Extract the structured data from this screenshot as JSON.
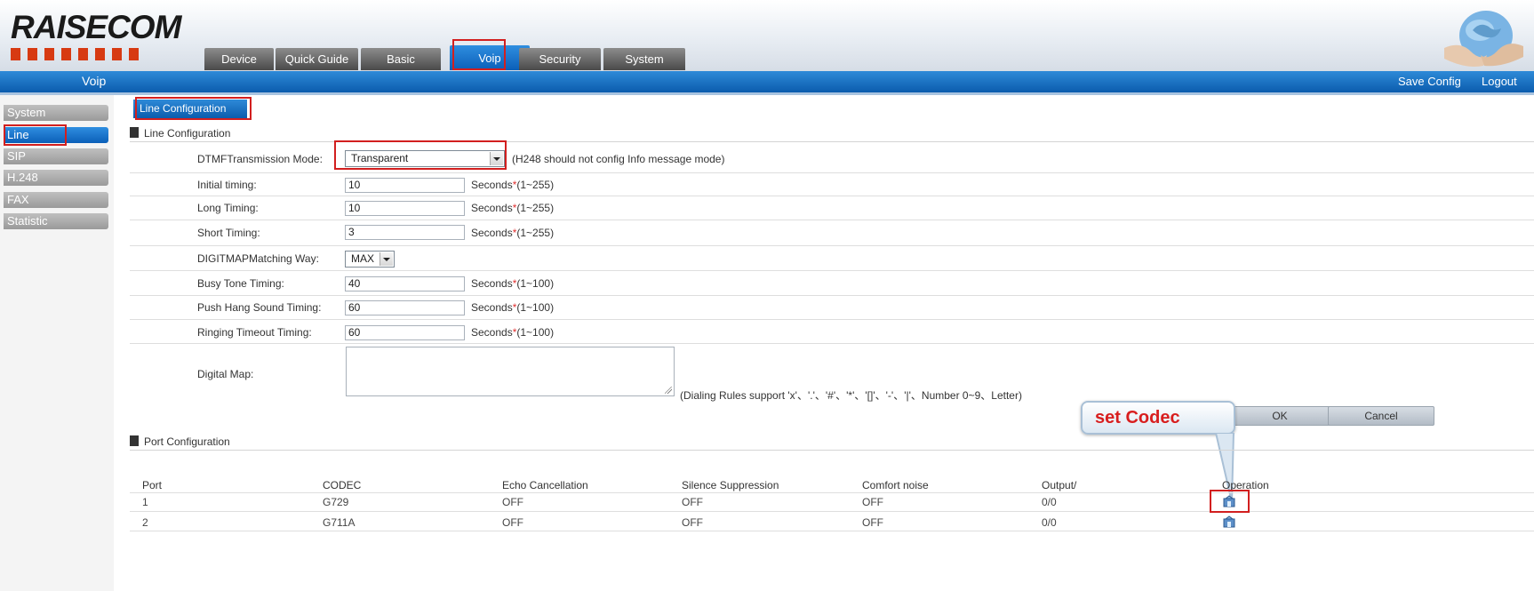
{
  "brand": {
    "logo_text": "RAISECOM"
  },
  "nav": {
    "tabs": [
      {
        "label": "Device"
      },
      {
        "label": "Quick Guide"
      },
      {
        "label": "Basic"
      },
      {
        "label": "Voip"
      },
      {
        "label": "Security"
      },
      {
        "label": "System"
      }
    ],
    "active_tab": "Voip"
  },
  "topbar": {
    "crumb": "Voip",
    "save_config": "Save Config",
    "logout": "Logout"
  },
  "sidebar": {
    "items": [
      {
        "label": "System"
      },
      {
        "label": "Line"
      },
      {
        "label": "SIP"
      },
      {
        "label": "H.248"
      },
      {
        "label": "FAX"
      },
      {
        "label": "Statistic"
      }
    ],
    "active": "Line"
  },
  "page_tab": "Line Configuration",
  "line_config": {
    "heading": "Line Configuration",
    "dtmf": {
      "label": "DTMFTransmission Mode:",
      "value": "Transparent",
      "note": "(H248 should not config Info message mode)"
    },
    "initial_timing": {
      "label": "Initial timing:",
      "value": "10",
      "unit": "Seconds",
      "range": "(1~255)"
    },
    "long_timing": {
      "label": "Long Timing:",
      "value": "10",
      "unit": "Seconds",
      "range": "(1~255)"
    },
    "short_timing": {
      "label": "Short Timing:",
      "value": "3",
      "unit": "Seconds",
      "range": "(1~255)"
    },
    "digitmap_matching": {
      "label": "DIGITMAPMatching Way:",
      "value": "MAX"
    },
    "busy_tone": {
      "label": "Busy Tone Timing:",
      "value": "40",
      "unit": "Seconds",
      "range": "(1~100)"
    },
    "push_hang": {
      "label": "Push Hang Sound Timing:",
      "value": "60",
      "unit": "Seconds",
      "range": "(1~100)"
    },
    "ringing_timeout": {
      "label": "Ringing Timeout Timing:",
      "value": "60",
      "unit": "Seconds",
      "range": "(1~100)"
    },
    "digital_map": {
      "label": "Digital Map:",
      "value": "",
      "note": "(Dialing Rules support 'x'、'.'、'#'、'*'、'[]'、'-'、'|'、Number 0~9、Letter)"
    }
  },
  "buttons": {
    "ok": "OK",
    "cancel": "Cancel"
  },
  "callout": "set Codec",
  "port_config": {
    "heading": "Port Configuration",
    "columns": [
      "Port",
      "CODEC",
      "Echo Cancellation",
      "Silence Suppression",
      "Comfort noise",
      "Output/",
      "Operation"
    ],
    "rows": [
      {
        "port": "1",
        "codec": "G729",
        "echo": "OFF",
        "silence": "OFF",
        "comfort": "OFF",
        "output": "0/0"
      },
      {
        "port": "2",
        "codec": "G711A",
        "echo": "OFF",
        "silence": "OFF",
        "comfort": "OFF",
        "output": "0/0"
      }
    ]
  }
}
